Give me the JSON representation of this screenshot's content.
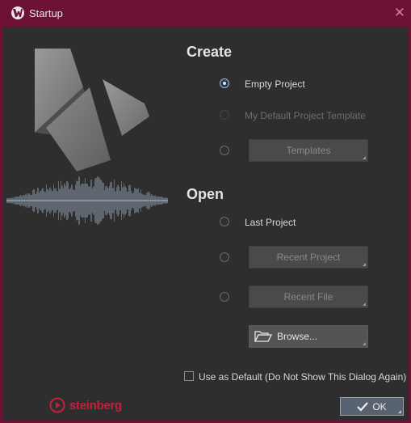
{
  "window": {
    "title": "Startup",
    "close_glyph": "✕",
    "accent_color": "#6d1234"
  },
  "create": {
    "heading": "Create",
    "options": [
      {
        "label": "Empty Project",
        "checked": true,
        "enabled": true
      },
      {
        "label": "My Default Project Template",
        "checked": false,
        "enabled": false
      },
      {
        "label": "",
        "checked": false,
        "enabled": true,
        "button": "Templates",
        "button_enabled": false
      }
    ]
  },
  "open": {
    "heading": "Open",
    "options": [
      {
        "label": "Last Project",
        "checked": false,
        "enabled": true
      },
      {
        "label": "",
        "checked": false,
        "enabled": true,
        "button": "Recent Project",
        "button_enabled": false
      },
      {
        "label": "",
        "checked": false,
        "enabled": true,
        "button": "Recent File",
        "button_enabled": false
      }
    ],
    "browse_label": "Browse...",
    "browse_icon": "folder-open-icon"
  },
  "footer": {
    "default_checkbox_label": "Use as Default (Do Not Show This Dialog Again)",
    "default_checkbox_checked": false,
    "brand": "steinberg",
    "ok_label": "OK"
  }
}
